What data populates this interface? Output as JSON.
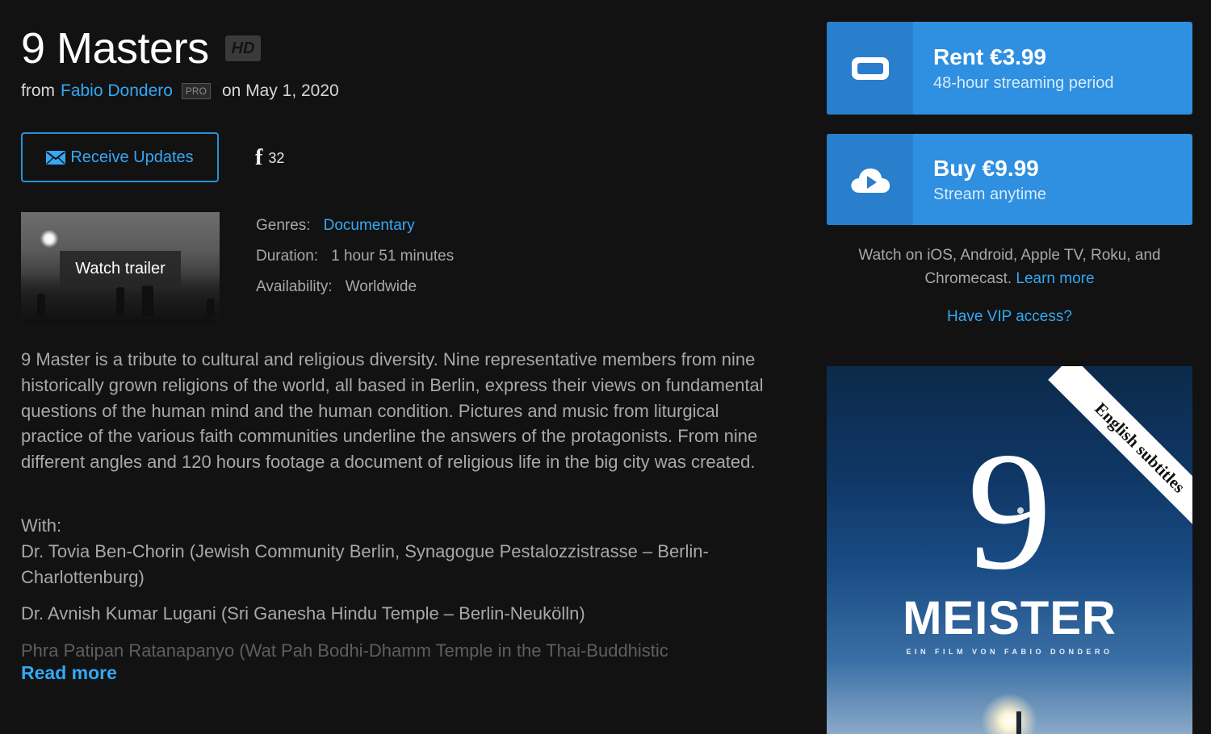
{
  "film": {
    "title": "9 Masters",
    "quality_badge": "HD",
    "byline_from": "from",
    "creator": "Fabio Dondero",
    "creator_badge": "PRO",
    "release": "on May 1, 2020"
  },
  "actions": {
    "receive_updates_label": "Receive Updates",
    "facebook_count": "32",
    "trailer_label": "Watch trailer"
  },
  "details": [
    {
      "key": "Genres:",
      "value": "Documentary",
      "link": true
    },
    {
      "key": "Duration:",
      "value": "1 hour 51 minutes",
      "link": false
    },
    {
      "key": "Availability:",
      "value": "Worldwide",
      "link": false
    }
  ],
  "description": "9 Master is a tribute to cultural and religious diversity. Nine representative members from nine historically grown religions of the world, all based in Berlin, express their views on fundamental questions of the human mind and the human condition. Pictures and music from liturgical practice of the various faith communities underline the answers of the protagonists. From nine different angles and 120 hours footage a document of religious life in the big city was created.",
  "cast": {
    "heading": "With:",
    "members": [
      "Dr. Tovia Ben-Chorin (Jewish Community Berlin, Synagogue Pestalozzistrasse – Berlin-Charlottenburg)",
      "Dr. Avnish Kumar Lugani (Sri Ganesha Hindu Temple – Berlin-Neukölln)",
      "Phra Patipan Ratanapanyo (Wat Pah Bodhi-Dhamm Temple in the Thai-Buddhistic"
    ],
    "read_more": "Read more"
  },
  "purchase": {
    "rent": {
      "label": "Rent €3.99",
      "sub": "48-hour streaming period",
      "icon": "ticket-icon"
    },
    "buy": {
      "label": "Buy €9.99",
      "sub": "Stream anytime",
      "icon": "cloud-play-icon"
    },
    "platforms_text": "Watch on iOS, Android, Apple TV, Roku, and Chromecast.",
    "learn_more": "Learn more",
    "vip": "Have VIP access?"
  },
  "poster": {
    "ribbon": "English subtitles",
    "numeral": "9",
    "title": "MEISTER",
    "credit": "EIN FILM VON FABIO DONDERO"
  },
  "colors": {
    "background": "#121212",
    "accent": "#34a8f4",
    "button_blue": "#2f8fe0"
  }
}
